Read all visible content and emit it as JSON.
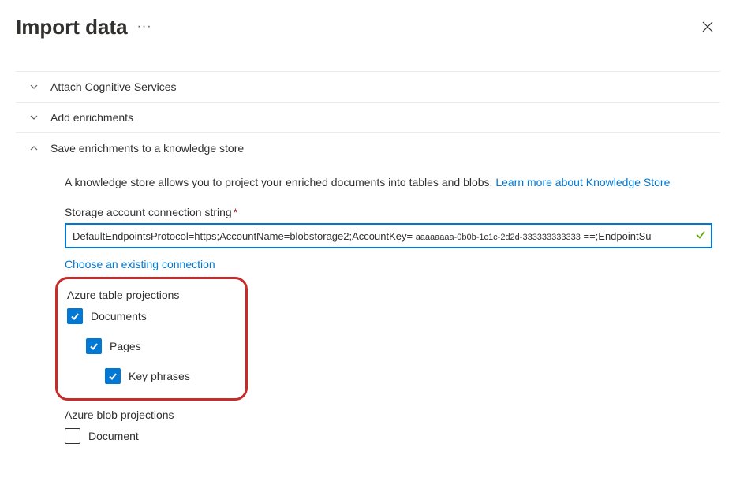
{
  "header": {
    "title": "Import data"
  },
  "sections": {
    "attach": {
      "label": "Attach Cognitive Services"
    },
    "enrich": {
      "label": "Add enrichments"
    },
    "save": {
      "label": "Save enrichments to a knowledge store",
      "description_pre": "A knowledge store allows you to project your enriched documents into tables and blobs. ",
      "description_link": "Learn more about Knowledge Store",
      "conn_label": "Storage account connection string",
      "conn_value_pre": "DefaultEndpointsProtocol=https;AccountName=blobstorage2;AccountKey= ",
      "conn_value_mid": "aaaaaaaa-0b0b-1c1c-2d2d-333333333333",
      "conn_value_post": " ==;EndpointSu",
      "choose_link": "Choose an existing connection",
      "table_proj": {
        "title": "Azure table projections",
        "documents": "Documents",
        "pages": "Pages",
        "keyphrases": "Key phrases"
      },
      "blob_proj": {
        "title": "Azure blob projections",
        "document": "Document"
      }
    }
  }
}
